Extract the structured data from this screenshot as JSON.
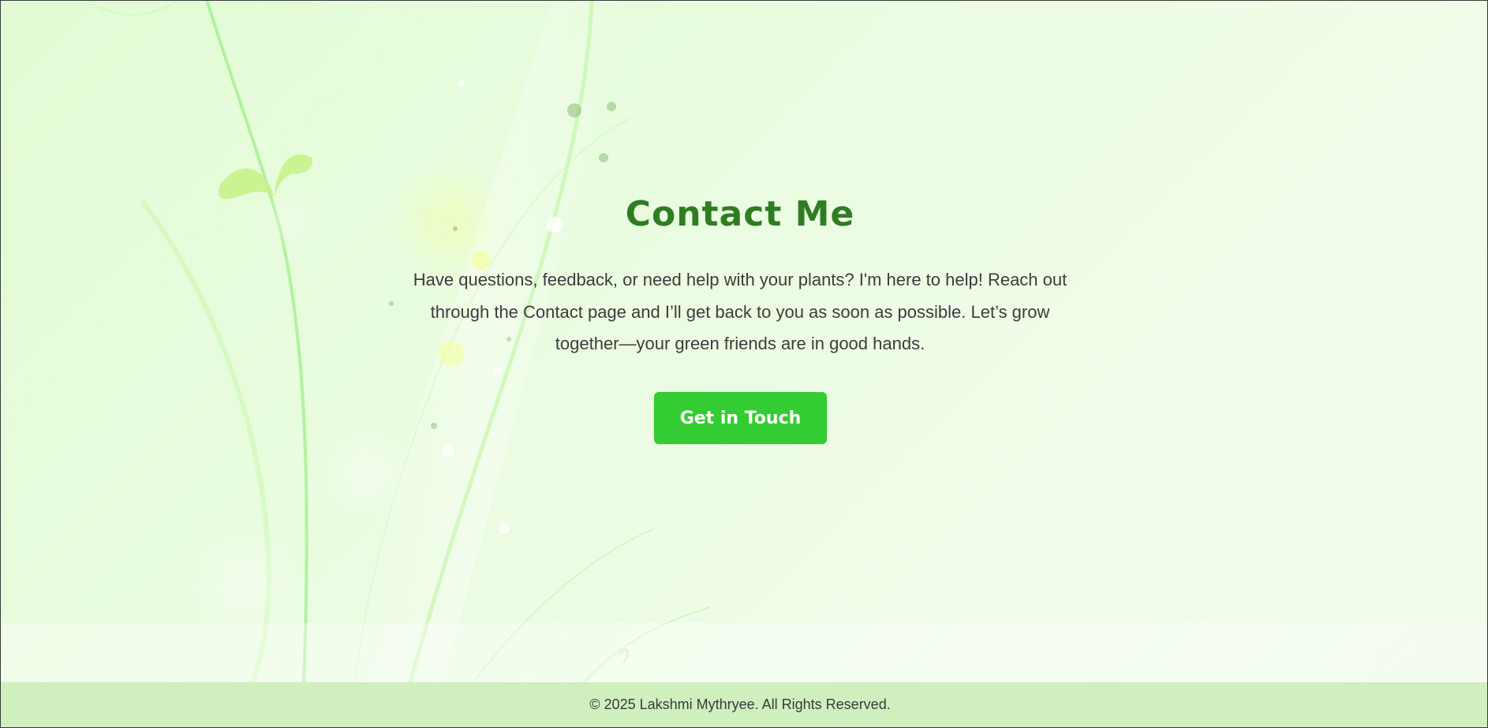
{
  "hero": {
    "title": "Contact Me",
    "description": "Have questions, feedback, or need help with your plants? I'm here to help! Reach out through the Contact page and I’ll get back to you as soon as possible. Let’s grow together—your green friends are in good hands.",
    "cta_label": "Get in Touch"
  },
  "footer": {
    "copyright": "© 2025 Lakshmi Mythryee. All Rights Reserved."
  },
  "colors": {
    "title": "#2e7d22",
    "button": "#33cc33",
    "footer_bg": "#cfefbf"
  },
  "decorations": {
    "background_icon": "plant-sprout-icon"
  }
}
